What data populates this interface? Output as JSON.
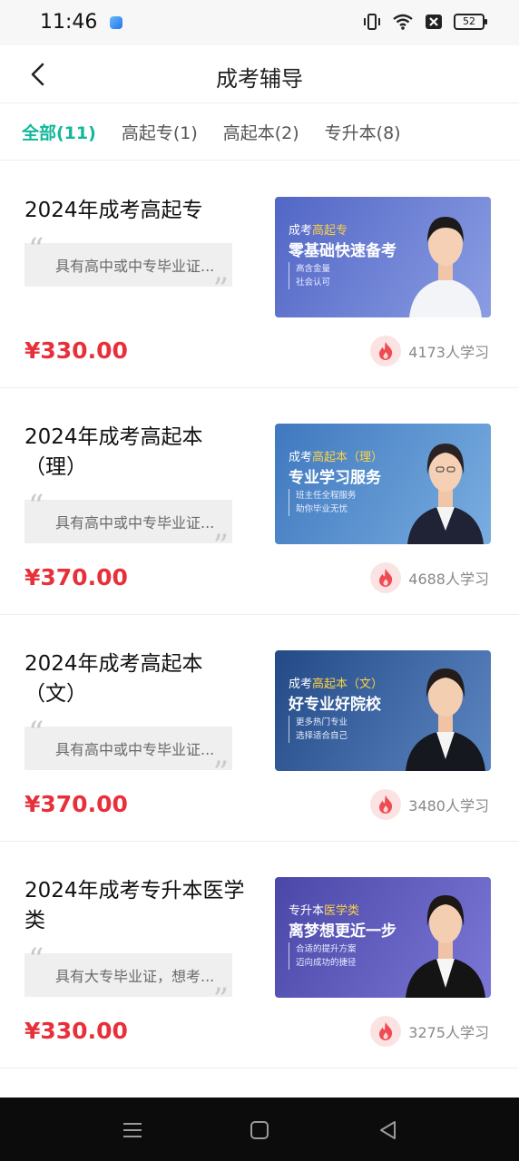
{
  "status_bar": {
    "time": "11:46",
    "battery": "52"
  },
  "nav": {
    "title": "成考辅导"
  },
  "tabs": [
    {
      "label": "全部(11)",
      "active": true
    },
    {
      "label": "高起专(1)",
      "active": false
    },
    {
      "label": "高起本(2)",
      "active": false
    },
    {
      "label": "专升本(8)",
      "active": false
    }
  ],
  "courses": [
    {
      "title": "2024年成考高起专",
      "summary": "具有高中或中专毕业证...",
      "price": "¥330.00",
      "learners": "4173人学习",
      "banner": {
        "prefix": "成考",
        "highlight": "高起专",
        "headline": "零基础快速备考",
        "sub1": "高含金量",
        "sub2": "社会认可",
        "bg1": "#5266c6",
        "bg2": "#8a9de3"
      }
    },
    {
      "title": "2024年成考高起本（理）",
      "summary": "具有高中或中专毕业证...",
      "price": "¥370.00",
      "learners": "4688人学习",
      "banner": {
        "prefix": "成考",
        "highlight": "高起本（理）",
        "headline": "专业学习服务",
        "sub1": "班主任全程服务",
        "sub2": "助你毕业无忧",
        "bg1": "#3f78bf",
        "bg2": "#79aee0"
      }
    },
    {
      "title": "2024年成考高起本（文）",
      "summary": "具有高中或中专毕业证...",
      "price": "¥370.00",
      "learners": "3480人学习",
      "banner": {
        "prefix": "成考",
        "highlight": "高起本（文）",
        "headline": "好专业好院校",
        "sub1": "更多热门专业",
        "sub2": "选择适合自己",
        "bg1": "#234a86",
        "bg2": "#5c86c2"
      }
    },
    {
      "title": "2024年成考专升本医学类",
      "summary": "具有大专毕业证，想考...",
      "price": "¥330.00",
      "learners": "3275人学习",
      "banner": {
        "prefix": "专升本",
        "highlight": "医学类",
        "headline": "离梦想更近一步",
        "sub1": "合适的提升方案",
        "sub2": "迈向成功的捷径",
        "bg1": "#4a47a8",
        "bg2": "#7b77d6"
      }
    }
  ],
  "colors": {
    "accent": "#11b89a",
    "price": "#e8303b"
  }
}
